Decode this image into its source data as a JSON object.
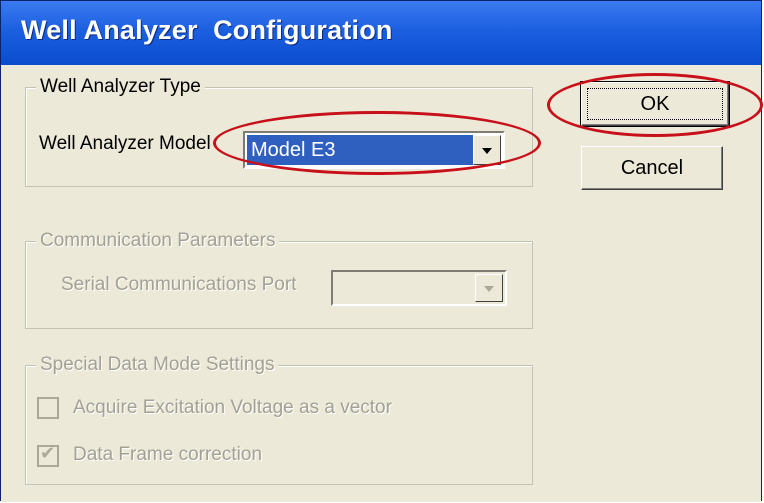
{
  "window": {
    "title": "Well Analyzer  Configuration"
  },
  "analyzer_type": {
    "legend": "Well Analyzer Type",
    "model_label": "Well Analyzer Model",
    "model_value": "Model E3"
  },
  "communication": {
    "legend": "Communication Parameters",
    "port_label": "Serial Communications Port",
    "port_value": ""
  },
  "special": {
    "legend": "Special Data Mode Settings",
    "opt1_label": "Acquire Excitation Voltage as a vector",
    "opt1_checked": false,
    "opt2_label": "Data Frame correction",
    "opt2_checked": true
  },
  "buttons": {
    "ok": "OK",
    "cancel": "Cancel"
  },
  "colors": {
    "titlebar": "#1c5fe0",
    "dialog": "#ece9d8",
    "annotation": "#c8101a",
    "selection": "#2f5fbf"
  },
  "icons": {
    "dropdown": "chevron-down-icon",
    "check": "check-icon"
  }
}
